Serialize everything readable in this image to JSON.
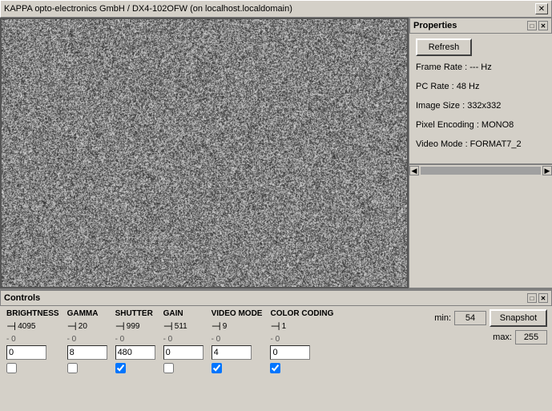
{
  "titleBar": {
    "title": "KAPPA opto-electronics GmbH / DX4-102OFW (on localhost.localdomain)",
    "closeLabel": "✕"
  },
  "properties": {
    "header": "Properties",
    "refreshLabel": "Refresh",
    "frameRate": "Frame Rate : --- Hz",
    "pcRate": "PC Rate : 48 Hz",
    "imageSize": "Image Size : 332x332",
    "pixelEncoding": "Pixel Encoding : MONO8",
    "videoMode": "Video Mode : FORMAT7_2",
    "headerIcons": [
      "□",
      "✕"
    ]
  },
  "controls": {
    "header": "Controls",
    "headerIcons": [
      "□",
      "✕"
    ],
    "groups": [
      {
        "id": "brightness",
        "label": "BRIGHTNESS",
        "maxVal": "4095",
        "minVal": "0",
        "inputVal": "0",
        "checked": false
      },
      {
        "id": "gamma",
        "label": "GAMMA",
        "maxVal": "20",
        "minVal": "0",
        "inputVal": "8",
        "checked": false
      },
      {
        "id": "shutter",
        "label": "SHUTTER",
        "maxVal": "999",
        "minVal": "0",
        "inputVal": "480",
        "checked": true
      },
      {
        "id": "gain",
        "label": "GAIN",
        "maxVal": "511",
        "minVal": "0",
        "inputVal": "0",
        "checked": false
      },
      {
        "id": "videomode",
        "label": "VIDEO MODE",
        "maxVal": "9",
        "minVal": "0",
        "inputVal": "4",
        "checked": true
      },
      {
        "id": "colorcoding",
        "label": "COLOR CODING",
        "maxVal": "1",
        "minVal": "0",
        "inputVal": "0",
        "checked": true
      }
    ],
    "minLabel": "min:",
    "maxLabel": "max:",
    "minVal": "54",
    "maxVal": "255",
    "snapshotLabel": "Snapshot"
  }
}
